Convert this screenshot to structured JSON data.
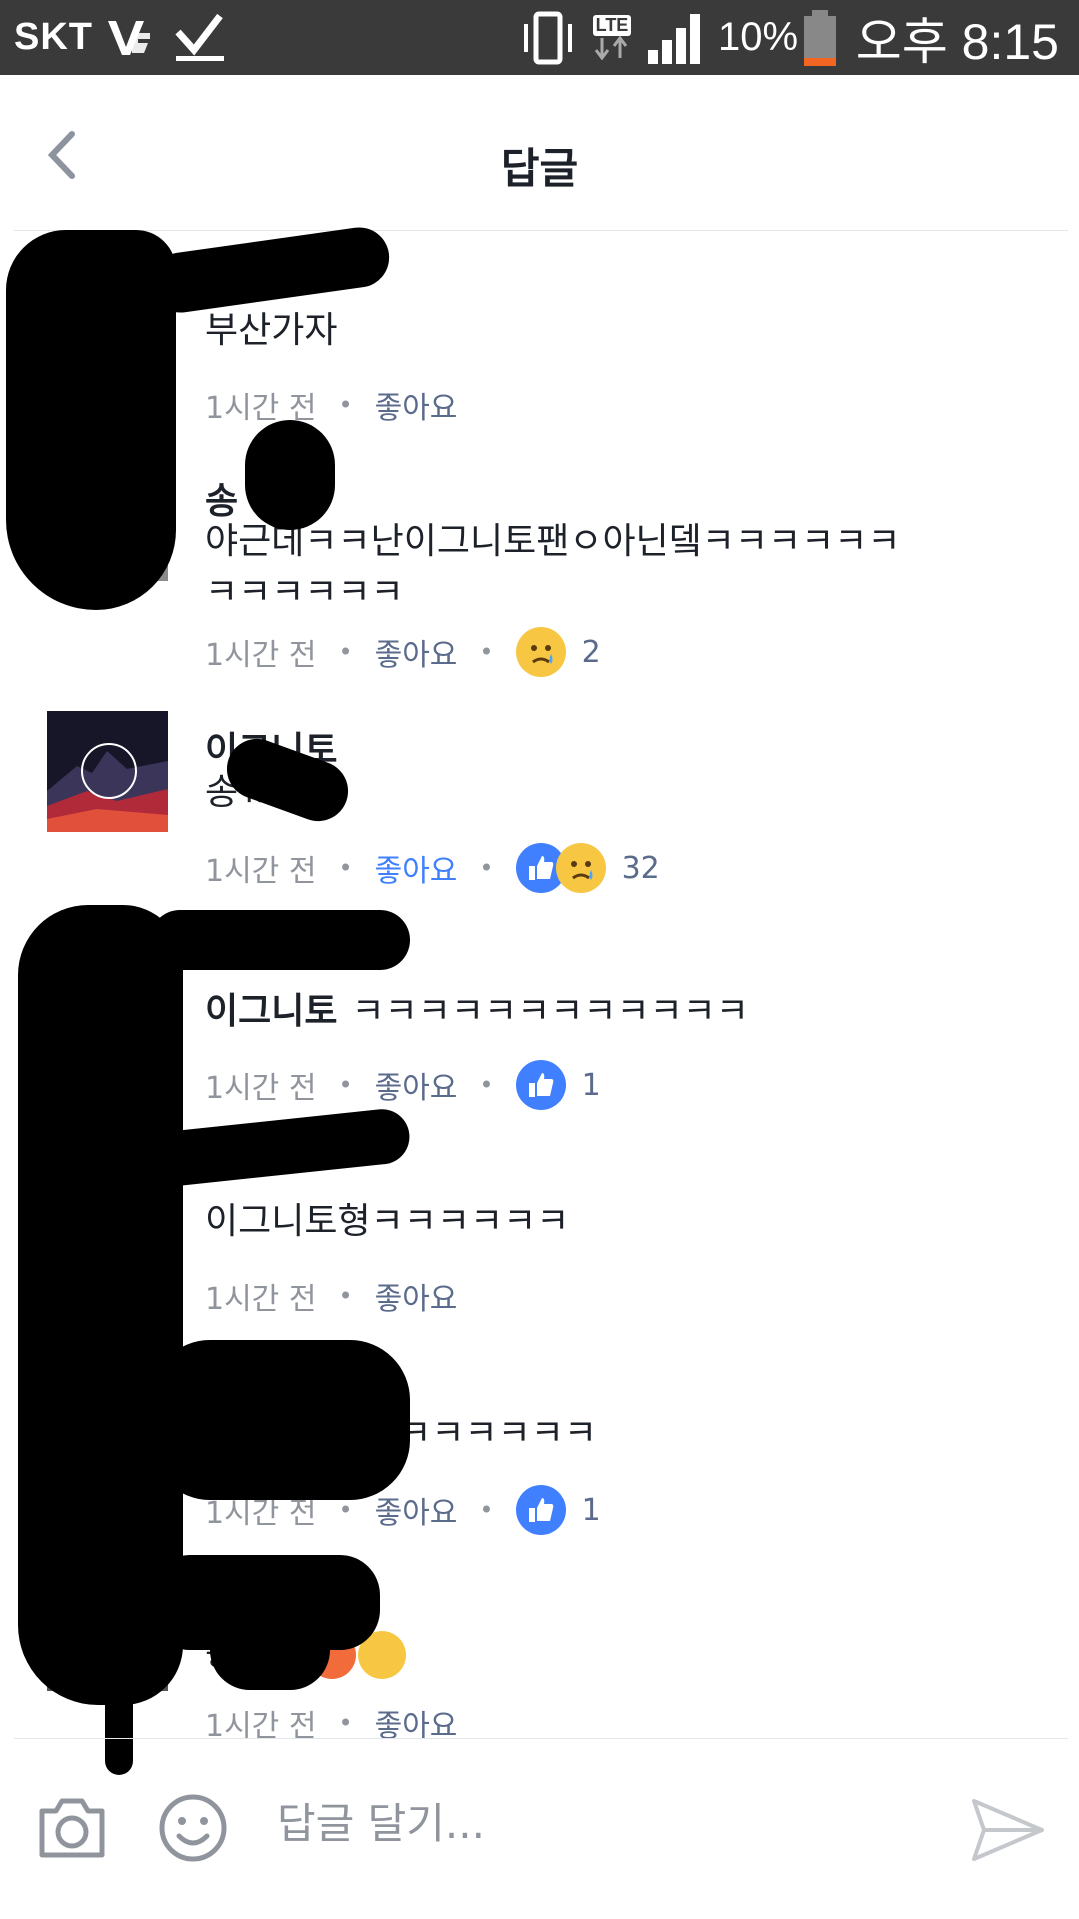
{
  "status_bar": {
    "carrier": "SKT",
    "network": "LTE",
    "battery": "10%",
    "time": "오후 8:15"
  },
  "header": {
    "title": "답글",
    "back_icon": "chevron-left-icon"
  },
  "comments": [
    {
      "author": "",
      "text": "부산가자",
      "time": "1시간 전",
      "like_label": "좋아요",
      "liked": false,
      "reactions": [],
      "count": ""
    },
    {
      "author": "송",
      "text": "야근데ㅋㅋ난이그니토팬ㅇ아닌뎈ㅋㅋㅋㅋㅋㅋ\nㅋㅋㅋㅋㅋㅋ",
      "time": "1시간 전",
      "like_label": "좋아요",
      "liked": false,
      "reactions": [
        "sad"
      ],
      "count": "2"
    },
    {
      "author": "이그니토",
      "text": "송ㅠㅠ",
      "time": "1시간 전",
      "like_label": "좋아요",
      "liked": true,
      "reactions": [
        "like",
        "sad"
      ],
      "count": "32"
    },
    {
      "author": "",
      "inline_author": "이그니토",
      "text": "ㅋㅋㅋㅋㅋㅋㅋㅋㅋㅋㅋㅋ",
      "time": "1시간 전",
      "like_label": "좋아요",
      "liked": false,
      "reactions": [
        "like"
      ],
      "count": "1"
    },
    {
      "author": "",
      "text": "이그니토형ㅋㅋㅋㅋㅋㅋ",
      "time": "1시간 전",
      "like_label": "좋아요",
      "liked": false,
      "reactions": [],
      "count": ""
    },
    {
      "author": "",
      "text": "글봘ㅋㅋㅋㅋㅋㅋ",
      "time": "1시간 전",
      "like_label": "좋아요",
      "liked": false,
      "reactions": [
        "like"
      ],
      "count": "1"
    },
    {
      "author": "",
      "text": "송",
      "time": "1시간 전",
      "like_label": "좋아요",
      "liked": false,
      "reactions": [],
      "count": ""
    }
  ],
  "composer": {
    "placeholder": "답글 달기...",
    "camera_icon": "camera-icon",
    "emoji_icon": "smiley-icon",
    "send_icon": "send-icon"
  },
  "colors": {
    "status_bar": "#3a3a3a",
    "link": "#5b6b8c",
    "like_active": "#4080ff",
    "meta_gray": "#90949c"
  }
}
